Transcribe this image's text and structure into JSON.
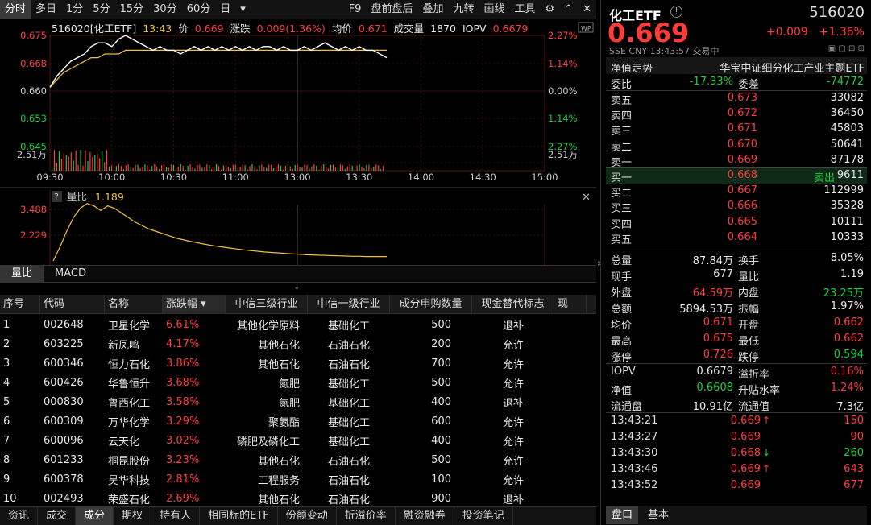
{
  "topbar": {
    "left_tabs": [
      "分时",
      "多日",
      "1分",
      "5分",
      "15分",
      "30分",
      "60分",
      "日"
    ],
    "dropdown": "▾",
    "right_tabs": [
      "F9",
      "盘前盘后",
      "叠加",
      "九转",
      "画线",
      "工具"
    ]
  },
  "info": {
    "code_name": "516020[化工ETF]",
    "time": "13:43",
    "price_label": "价",
    "price": "0.669",
    "change_label": "涨跌",
    "change": "0.009(1.36%)",
    "avg_label": "均价",
    "avg": "0.671",
    "vol_label": "成交量",
    "vol": "1870",
    "iopv_label": "IOPV",
    "iopv": "0.6679"
  },
  "chart_data": [
    {
      "type": "line",
      "title": "",
      "y_left_ticks": [
        "0.675",
        "0.668",
        "0.660",
        "0.653",
        "0.645"
      ],
      "y_right_ticks": [
        "2.27%",
        "1.14%",
        "0.00%",
        "1.14%",
        "2.27%"
      ],
      "vol_tick": "2.51万",
      "x_ticks": [
        "09:30",
        "10:00",
        "10:30",
        "11:00",
        "13:00",
        "13:30",
        "14:00",
        "14:30",
        "15:00"
      ],
      "ylim": [
        0.645,
        0.675
      ],
      "series": [
        {
          "name": "价",
          "color": "#ffffff",
          "values": [
            0.661,
            0.664,
            0.666,
            0.668,
            0.669,
            0.67,
            0.672,
            0.673,
            0.673,
            0.672,
            0.674,
            0.675,
            0.674,
            0.673,
            0.672,
            0.671,
            0.672,
            0.671,
            0.671,
            0.67,
            0.671,
            0.672,
            0.671,
            0.672,
            0.671,
            0.672,
            0.671,
            0.672,
            0.671,
            0.672,
            0.671,
            0.672,
            0.672,
            0.671,
            0.672,
            0.671,
            0.671,
            0.672,
            0.671,
            0.672,
            0.673,
            0.672,
            0.671,
            0.672,
            0.671,
            0.672,
            0.671,
            0.671,
            0.67,
            0.669
          ]
        },
        {
          "name": "均价",
          "color": "#f0c040",
          "values": [
            0.661,
            0.663,
            0.665,
            0.666,
            0.667,
            0.668,
            0.669,
            0.669,
            0.67,
            0.67,
            0.67,
            0.671,
            0.671,
            0.671,
            0.671,
            0.671,
            0.671,
            0.671,
            0.671,
            0.671,
            0.671,
            0.671,
            0.671,
            0.671,
            0.671,
            0.671,
            0.671,
            0.671,
            0.671,
            0.671,
            0.671,
            0.671,
            0.671,
            0.671,
            0.671,
            0.671,
            0.671,
            0.671,
            0.671,
            0.671,
            0.671,
            0.671,
            0.671,
            0.671,
            0.671,
            0.671,
            0.671,
            0.671,
            0.671,
            0.671
          ]
        }
      ]
    },
    {
      "type": "line",
      "title": "量比",
      "value": "1.189",
      "y_ticks": [
        "3.488",
        "2.229"
      ],
      "ylim": [
        1.0,
        3.6
      ],
      "series": [
        {
          "name": "量比",
          "color": "#f0c040",
          "values": [
            1.0,
            1.6,
            2.3,
            2.9,
            3.3,
            3.5,
            3.4,
            3.2,
            3.4,
            3.3,
            3.1,
            2.9,
            2.7,
            2.55,
            2.4,
            2.3,
            2.2,
            2.1,
            2.0,
            1.93,
            1.86,
            1.8,
            1.74,
            1.69,
            1.64,
            1.6,
            1.56,
            1.52,
            1.48,
            1.45,
            1.42,
            1.39,
            1.37,
            1.35,
            1.33,
            1.31,
            1.29,
            1.27,
            1.26,
            1.25,
            1.24,
            1.23,
            1.22,
            1.21,
            1.2,
            1.2,
            1.19,
            1.19,
            1.19,
            1.19
          ]
        }
      ]
    }
  ],
  "subtabs": [
    "量比",
    "MACD"
  ],
  "table": {
    "headers": [
      "序号",
      "代码",
      "名称",
      "涨跌幅 ▾",
      "中信三级行业",
      "中信一级行业",
      "成分申购数量",
      "现金替代标志",
      "现"
    ],
    "rows": [
      [
        "1",
        "002648",
        "卫星化学",
        "6.61%",
        "其他化学原料",
        "基础化工",
        "500",
        "退补"
      ],
      [
        "2",
        "603225",
        "新凤鸣",
        "4.17%",
        "其他石化",
        "石油石化",
        "200",
        "允许"
      ],
      [
        "3",
        "600346",
        "恒力石化",
        "3.86%",
        "其他石化",
        "石油石化",
        "700",
        "允许"
      ],
      [
        "4",
        "600426",
        "华鲁恒升",
        "3.68%",
        "氮肥",
        "基础化工",
        "500",
        "允许"
      ],
      [
        "5",
        "000830",
        "鲁西化工",
        "3.58%",
        "氮肥",
        "基础化工",
        "400",
        "退补"
      ],
      [
        "6",
        "600309",
        "万华化学",
        "3.29%",
        "聚氨酯",
        "基础化工",
        "600",
        "允许"
      ],
      [
        "7",
        "600096",
        "云天化",
        "3.02%",
        "磷肥及磷化工",
        "基础化工",
        "400",
        "允许"
      ],
      [
        "8",
        "601233",
        "桐昆股份",
        "3.23%",
        "其他石化",
        "石油石化",
        "500",
        "允许"
      ],
      [
        "9",
        "600378",
        "昊华科技",
        "2.81%",
        "工程服务",
        "石油石化",
        "100",
        "允许"
      ],
      [
        "10",
        "002493",
        "荣盛石化",
        "2.69%",
        "其他石化",
        "石油石化",
        "900",
        "退补"
      ]
    ]
  },
  "bottomtabs": [
    "资讯",
    "成交",
    "成分",
    "期权",
    "持有人",
    "相同标的ETF",
    "份额变动",
    "折溢价率",
    "融资融券",
    "投资笔记"
  ],
  "quote": {
    "name": "化工ETF",
    "code": "516020",
    "price": "0.669",
    "change": "+0.009",
    "pct": "+1.36%",
    "market": "SSE",
    "currency": "CNY",
    "time": "13:43:57",
    "status": "交易中",
    "nav_label": "净值走势",
    "fund_name": "华宝中证细分化工产业主题ETF",
    "weibi_label": "委比",
    "weibi": "-17.33%",
    "weicha_label": "委差",
    "weicha": "-74772",
    "asks": [
      {
        "label": "卖五",
        "price": "0.673",
        "vol": "33082"
      },
      {
        "label": "卖四",
        "price": "0.672",
        "vol": "36450"
      },
      {
        "label": "卖三",
        "price": "0.671",
        "vol": "45803"
      },
      {
        "label": "卖二",
        "price": "0.670",
        "vol": "50641"
      },
      {
        "label": "卖一",
        "price": "0.669",
        "vol": "87178"
      }
    ],
    "bids": [
      {
        "label": "买一",
        "price": "0.668",
        "vol": "9611",
        "tag": "卖出"
      },
      {
        "label": "买二",
        "price": "0.667",
        "vol": "112999",
        "tag": ""
      },
      {
        "label": "买三",
        "price": "0.666",
        "vol": "35328",
        "tag": ""
      },
      {
        "label": "买四",
        "price": "0.665",
        "vol": "10111",
        "tag": ""
      },
      {
        "label": "买五",
        "price": "0.664",
        "vol": "10333",
        "tag": ""
      }
    ],
    "stats": [
      {
        "l1": "总量",
        "v1": "87.84万",
        "c1": "white",
        "l2": "换手",
        "v2": "8.05%",
        "c2": "white"
      },
      {
        "l1": "现手",
        "v1": "677",
        "c1": "white",
        "l2": "量比",
        "v2": "1.19",
        "c2": "white"
      },
      {
        "l1": "外盘",
        "v1": "64.59万",
        "c1": "red",
        "l2": "内盘",
        "v2": "23.25万",
        "c2": "green"
      },
      {
        "l1": "总额",
        "v1": "5894.53万",
        "c1": "white",
        "l2": "振幅",
        "v2": "1.97%",
        "c2": "white"
      },
      {
        "l1": "均价",
        "v1": "0.671",
        "c1": "red",
        "l2": "开盘",
        "v2": "0.662",
        "c2": "red"
      },
      {
        "l1": "最高",
        "v1": "0.675",
        "c1": "red",
        "l2": "最低",
        "v2": "0.662",
        "c2": "red"
      },
      {
        "l1": "涨停",
        "v1": "0.726",
        "c1": "red",
        "l2": "跌停",
        "v2": "0.594",
        "c2": "green"
      }
    ],
    "stats2": [
      {
        "l1": "IOPV",
        "v1": "0.6679",
        "c1": "white",
        "l2": "溢折率",
        "v2": "0.16%",
        "c2": "red"
      },
      {
        "l1": "净值",
        "v1": "0.6608",
        "c1": "green",
        "l2": "升贴水率",
        "v2": "1.24%",
        "c2": "red"
      },
      {
        "l1": "流通盘",
        "v1": "10.91亿",
        "c1": "white",
        "l2": "流通值",
        "v2": "7.3亿",
        "c2": "white"
      }
    ],
    "trades": [
      {
        "time": "13:43:21",
        "price": "0.669",
        "dir": "↑",
        "vol": "150",
        "vc": "red"
      },
      {
        "time": "13:43:27",
        "price": "0.669",
        "dir": "",
        "vol": "90",
        "vc": "red"
      },
      {
        "time": "13:43:30",
        "price": "0.668",
        "dir": "↓",
        "vol": "260",
        "vc": "green"
      },
      {
        "time": "13:43:46",
        "price": "0.669",
        "dir": "↑",
        "vol": "643",
        "vc": "red"
      },
      {
        "time": "13:43:52",
        "price": "0.669",
        "dir": "",
        "vol": "677",
        "vc": "red"
      }
    ],
    "tabs": [
      "盘口",
      "基本"
    ]
  }
}
